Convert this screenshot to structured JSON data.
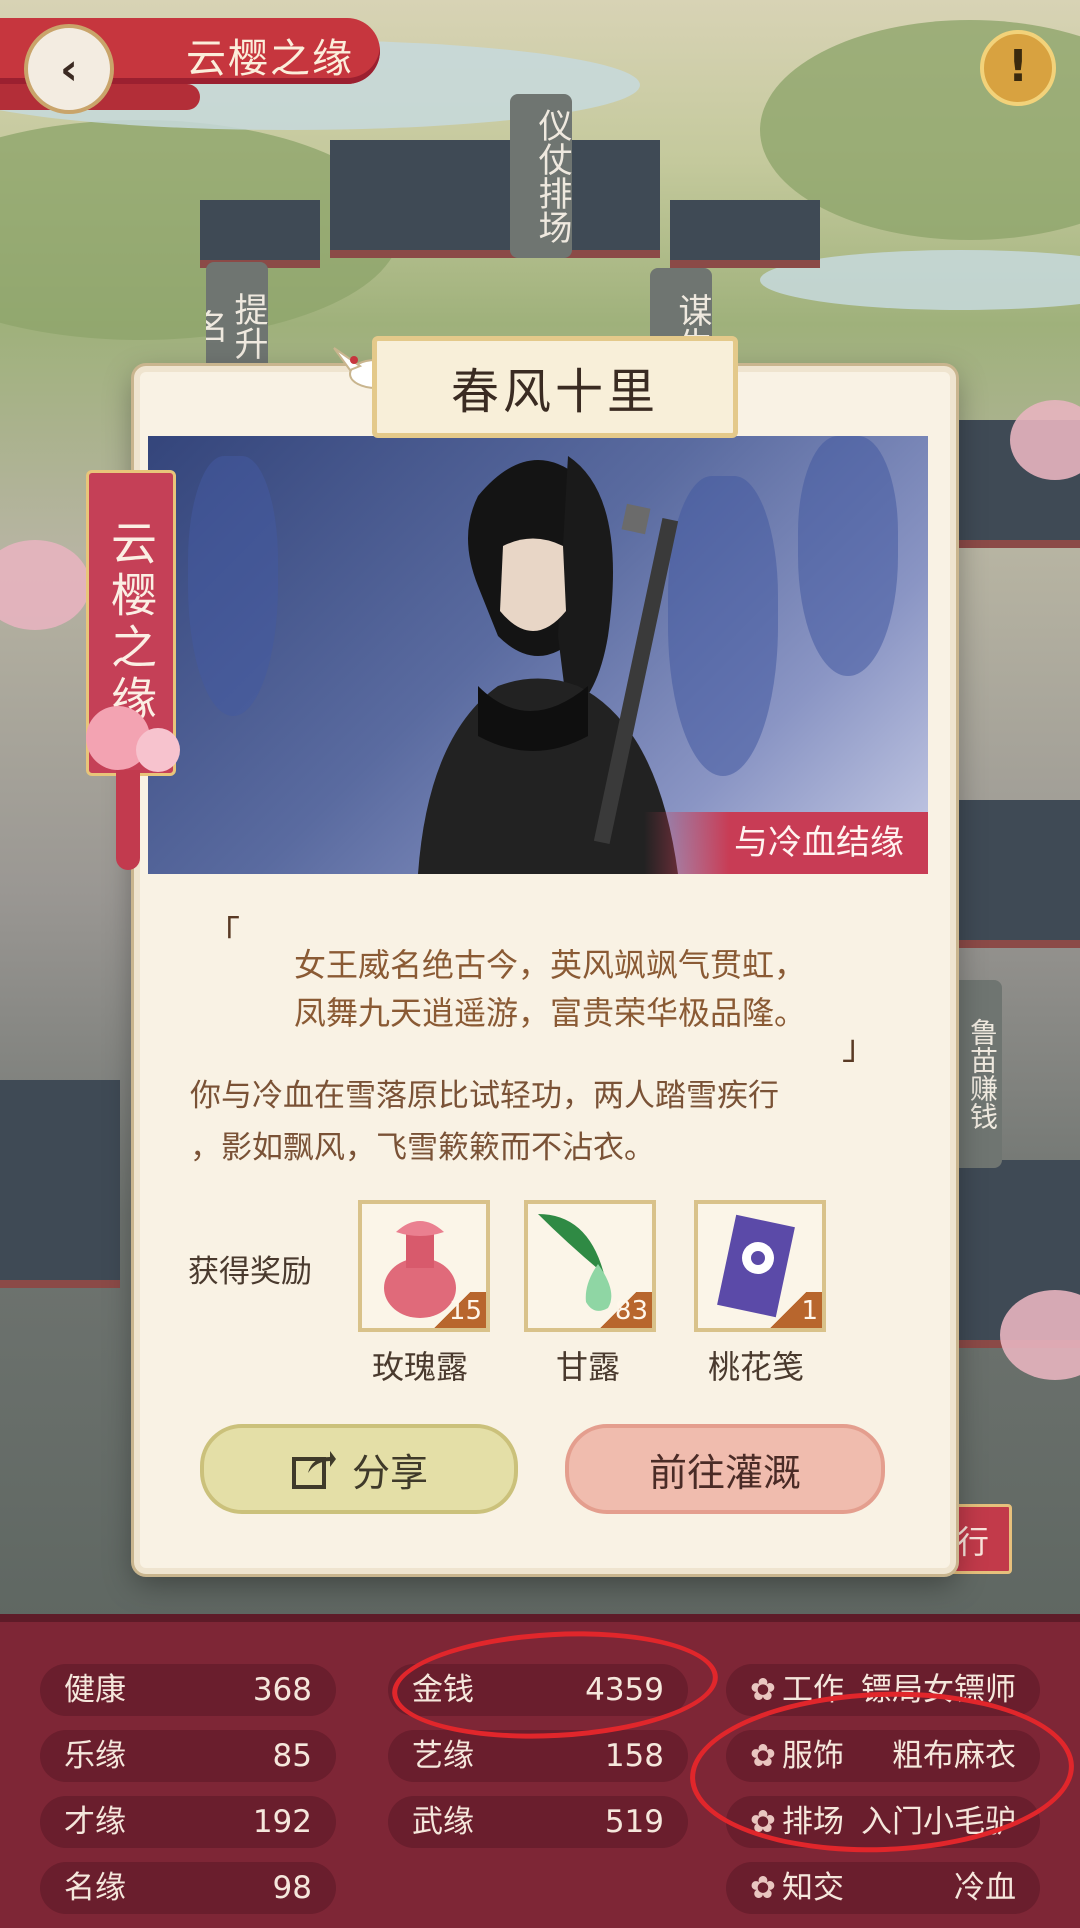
{
  "top_bar": {
    "title": "云樱之缘"
  },
  "map_signs": [
    "仪仗排场",
    "提升名",
    "谋生",
    "鲁苗赚钱"
  ],
  "card": {
    "title": "春风十里",
    "side_banner": "云樱之缘",
    "portrait_tag": "与冷血结缘",
    "poem_lines": [
      "女王威名绝古今，英风飒飒气贯虹，",
      "凤舞九天逍遥游，富贵荣华极品隆。"
    ],
    "story_lines": [
      "你与冷血在雪落原比试轻功，两人踏雪疾行",
      "，影如飘风，飞雪簌簌而不沾衣。"
    ],
    "rewards_label": "获得奖励",
    "rewards": [
      {
        "name": "玫瑰露",
        "count": "15",
        "icon": "rose-dew-bottle-icon"
      },
      {
        "name": "甘露",
        "count": "83",
        "icon": "dew-drop-leaf-icon"
      },
      {
        "name": "桃花笺",
        "count": "1",
        "icon": "peach-blossom-letter-icon"
      }
    ],
    "share_label": "分享",
    "go_label": "前往灌溉"
  },
  "side_button_label": "行",
  "stats": {
    "col1": [
      {
        "key": "健康",
        "value": "368"
      },
      {
        "key": "乐缘",
        "value": "85"
      },
      {
        "key": "才缘",
        "value": "192"
      },
      {
        "key": "名缘",
        "value": "98"
      }
    ],
    "col2": [
      {
        "key": "金钱",
        "value": "4359"
      },
      {
        "key": "艺缘",
        "value": "158"
      },
      {
        "key": "武缘",
        "value": "519"
      }
    ],
    "col3": [
      {
        "key": "工作",
        "value": "镖局女镖师"
      },
      {
        "key": "服饰",
        "value": "粗布麻衣"
      },
      {
        "key": "排场",
        "value": "入门小毛驴"
      },
      {
        "key": "知交",
        "value": "冷血"
      }
    ]
  },
  "colors": {
    "accent_red": "#c6363e",
    "panel": "#7e2636",
    "annotation": "#e1262b"
  }
}
